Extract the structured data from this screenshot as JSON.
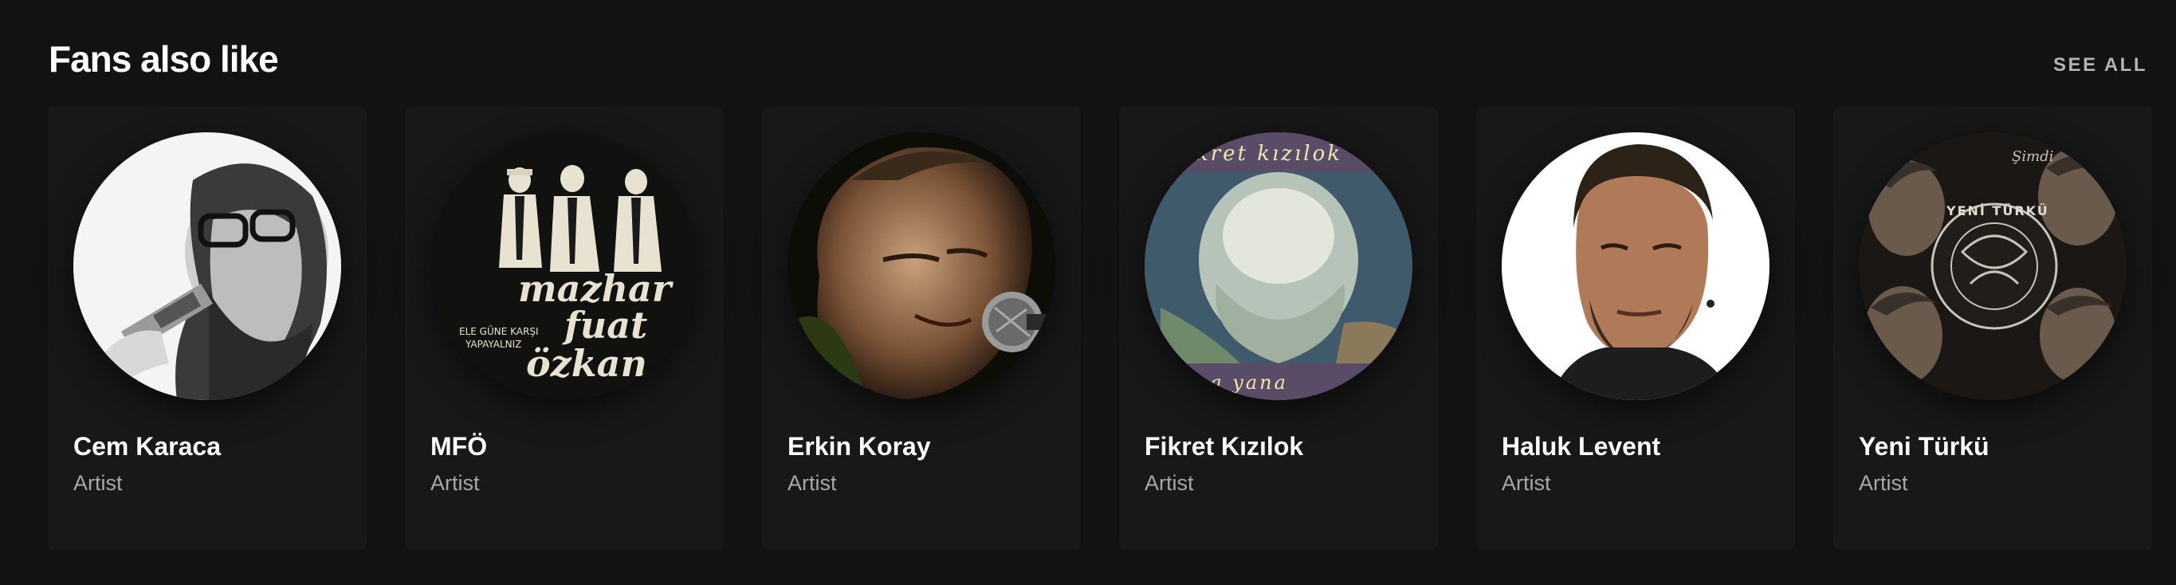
{
  "section": {
    "title": "Fans also like",
    "see_all_label": "SEE ALL"
  },
  "artists": [
    {
      "name": "Cem Karaca",
      "subtitle": "Artist",
      "image_icon": "singer-with-microphone-photo"
    },
    {
      "name": "MFÖ",
      "subtitle": "Artist",
      "image_icon": "band-album-cover",
      "cover_text": [
        "mazhar",
        "fuat",
        "özkan"
      ],
      "cover_small_text": [
        "ELE GÜNE KARŞI",
        "YAPAYALNIZ"
      ]
    },
    {
      "name": "Erkin Koray",
      "subtitle": "Artist",
      "image_icon": "singer-at-microphone-photo"
    },
    {
      "name": "Fikret Kızılok",
      "subtitle": "Artist",
      "image_icon": "album-cover-portrait",
      "cover_text": [
        "fikret kızılok",
        "yana yana"
      ]
    },
    {
      "name": "Haluk Levent",
      "subtitle": "Artist",
      "image_icon": "man-portrait-photo"
    },
    {
      "name": "Yeni Türkü",
      "subtitle": "Artist",
      "image_icon": "band-collage-logo",
      "cover_text": [
        "Şimdi",
        "YENİ TÜRKÜ"
      ]
    }
  ],
  "colors": {
    "background": "#121212",
    "card": "#181818",
    "title": "#ffffff",
    "subtitle": "#a7a7a7",
    "see_all": "#b3b3b3"
  }
}
